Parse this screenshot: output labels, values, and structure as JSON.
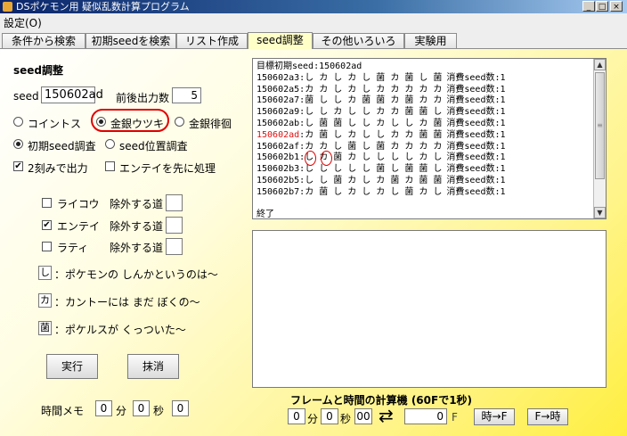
{
  "window": {
    "title": "DSポケモン用 疑似乱数計算プログラム"
  },
  "menubar": {
    "settings": "設定(O)"
  },
  "tabs": [
    "条件から検索",
    "初期seedを検索",
    "リスト作成",
    "seed調整",
    "その他いろいろ",
    "実験用"
  ],
  "seed_adjust": {
    "heading": "seed調整",
    "seed_label": "seed",
    "seed_value": "150602ad",
    "range_label": "前後出力数",
    "range_value": "5",
    "games": {
      "coin": "コイントス",
      "kingin_utsuki": "金銀ウツキ",
      "kingin_haikai": "金銀徘徊"
    },
    "modes": {
      "initial_seed": "初期seed調査",
      "seed_position": "seed位置調査"
    },
    "options": {
      "two_step": "2刻みで出力",
      "entei_first": "エンテイを先に処理"
    },
    "beasts": [
      {
        "name": "ライコウ",
        "exclude_label": "除外する道",
        "checked": false,
        "value": ""
      },
      {
        "name": "エンテイ",
        "exclude_label": "除外する道",
        "checked": true,
        "value": ""
      },
      {
        "name": "ラティ",
        "exclude_label": "除外する道",
        "checked": false,
        "value": ""
      }
    ],
    "legend": [
      {
        "symbol": "し",
        "text": "：ポケモンの しんかというのは～"
      },
      {
        "symbol": "カ",
        "text": "：カントーには まだ ぼくの～"
      },
      {
        "symbol": "菌",
        "text": "：ポケルスが くっついた～"
      }
    ],
    "run_button": "実行",
    "clear_button": "抹消",
    "time_memo": {
      "label": "時間メモ",
      "min_value": "0",
      "min_unit": "分",
      "sec_value": "0",
      "sec_unit": "秒",
      "frame_value": "0"
    }
  },
  "output": {
    "header": "目標初期seed:150602ad",
    "rows": [
      {
        "seed": "150602a3",
        "seq": "し カ し カ し 菌 カ 菌 し 菌",
        "consumed": "消費seed数:1",
        "highlight": false
      },
      {
        "seed": "150602a5",
        "seq": "カ カ し カ し カ カ カ カ カ",
        "consumed": "消費seed数:1",
        "highlight": false
      },
      {
        "seed": "150602a7",
        "seq": "菌 し し カ 菌 菌 カ 菌 カ カ",
        "consumed": "消費seed数:1",
        "highlight": false
      },
      {
        "seed": "150602a9",
        "seq": "し し カ し し カ カ 菌 菌 し",
        "consumed": "消費seed数:1",
        "highlight": false
      },
      {
        "seed": "150602ab",
        "seq": "し 菌 菌 し し カ し し カ 菌",
        "consumed": "消費seed数:1",
        "highlight": false
      },
      {
        "seed": "150602ad",
        "seq": "カ 菌 し カ し し カ カ 菌 菌",
        "consumed": "消費seed数:1",
        "highlight": true
      },
      {
        "seed": "150602af",
        "seq": "カ カ し 菌 し 菌 カ カ カ カ",
        "consumed": "消費seed数:1",
        "highlight": false
      },
      {
        "seed": "150602b1",
        "seq": "し カ 菌 カ し し し し カ し",
        "consumed": "消費seed数:1",
        "highlight": false
      },
      {
        "seed": "150602b3",
        "seq": "し し し し し 菌 し 菌 菌 し",
        "consumed": "消費seed数:1",
        "highlight": false
      },
      {
        "seed": "150602b5",
        "seq": "し し 菌 カ し カ 菌 カ 菌 菌",
        "consumed": "消費seed数:1",
        "highlight": false
      },
      {
        "seed": "150602b7",
        "seq": "カ 菌 し カ し カ し 菌 カ し",
        "consumed": "消費seed数:1",
        "highlight": false
      }
    ],
    "footer": "終了"
  },
  "frame_calc": {
    "title": "フレームと時間の計算機 (60Fで1秒)",
    "min_value": "0",
    "min_unit": "分",
    "sec_value": "0",
    "sec_unit": "秒",
    "frames_value": "00",
    "swap_symbol": "⇄",
    "f_value": "0",
    "f_unit": "F",
    "time_to_frame": "時→F",
    "frame_to_time": "F→時"
  },
  "colors": {
    "highlight_seed": "#e01010",
    "annotation": "#e00000"
  }
}
